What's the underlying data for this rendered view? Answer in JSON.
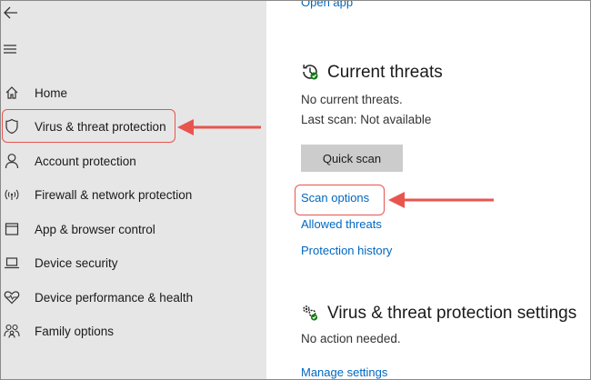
{
  "sidebar": {
    "items": [
      {
        "label": "Home",
        "icon": "home-icon"
      },
      {
        "label": "Virus & threat protection",
        "icon": "shield-icon"
      },
      {
        "label": "Account protection",
        "icon": "person-icon"
      },
      {
        "label": "Firewall & network protection",
        "icon": "wifi-icon"
      },
      {
        "label": "App & browser control",
        "icon": "app-window-icon"
      },
      {
        "label": "Device security",
        "icon": "laptop-icon"
      },
      {
        "label": "Device performance & health",
        "icon": "heart-icon"
      },
      {
        "label": "Family options",
        "icon": "family-icon"
      }
    ]
  },
  "main": {
    "open_app_link": "Open app",
    "current_threats": {
      "title": "Current threats",
      "status": "No current threats.",
      "last_scan": "Last scan: Not available",
      "quick_scan_label": "Quick scan",
      "scan_options_link": "Scan options",
      "allowed_threats_link": "Allowed threats",
      "protection_history_link": "Protection history"
    },
    "settings": {
      "title": "Virus & threat protection settings",
      "status": "No action needed.",
      "manage_link": "Manage settings"
    }
  },
  "colors": {
    "sidebar_bg": "#e6e6e6",
    "link": "#0067c0",
    "annotation_red": "#e8554f",
    "button_bg": "#cccccc",
    "status_green": "#107c10"
  }
}
